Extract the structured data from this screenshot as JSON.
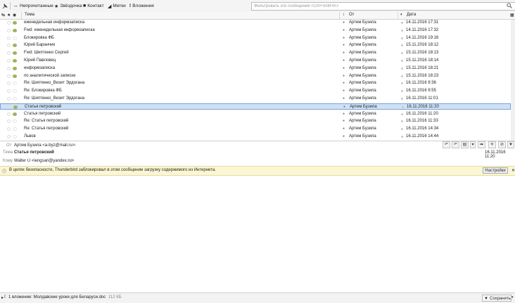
{
  "filterbar": {
    "unread": "Непрочитанные",
    "starred": "Звёздочка",
    "contact": "Контакт",
    "tags": "Метки",
    "attachments": "Вложения",
    "placeholder": "Фильтровать эти сообщения <Ctrl+Shift+K>"
  },
  "columns": {
    "subject": "Тема",
    "from": "От",
    "date": "Дата"
  },
  "messages": [
    {
      "subject": "еженедельная информзаписка",
      "from": "Артем Бузила",
      "date": "14.11.2016 17:31",
      "tagged": true
    },
    {
      "subject": "Fwd: еженедельная информзаписка",
      "from": "Артем Бузила",
      "date": "14.11.2016 17:32",
      "tagged": true
    },
    {
      "subject": "Блокировка ФБ",
      "from": "Артем Бузила",
      "date": "14.11.2016 19:16",
      "tagged": false
    },
    {
      "subject": "Юрий Баранчик",
      "from": "Артем Бузила",
      "date": "15.11.2016 18:12",
      "tagged": true
    },
    {
      "subject": "Fwd: Шиптенко Сергей",
      "from": "Артем Бузила",
      "date": "15.11.2016 18:13",
      "tagged": true
    },
    {
      "subject": "Юрий Павловец",
      "from": "Артем Бузила",
      "date": "15.11.2016 18:14",
      "tagged": true
    },
    {
      "subject": "информзаписка",
      "from": "Артем Бузила",
      "date": "15.11.2016 18:21",
      "tagged": true
    },
    {
      "subject": "по аналитической записке",
      "from": "Артем Бузила",
      "date": "15.11.2016 18:23",
      "tagged": true
    },
    {
      "subject": "Re: Шиптенко_Визит Эрдогана",
      "from": "Артем Бузила",
      "date": "16.11.2016 9:36",
      "tagged": false
    },
    {
      "subject": "Re: Блокировка ФБ",
      "from": "Артем Бузила",
      "date": "16.11.2016 9:55",
      "tagged": false
    },
    {
      "subject": "Re: Шиптенко_Визит Эрдогана",
      "from": "Артем Бузила",
      "date": "16.11.2016 11:01",
      "tagged": false
    },
    {
      "subject": "Статья петровский",
      "from": "Артем Бузила",
      "date": "16.11.2016 11:20",
      "tagged": true,
      "selected": true
    },
    {
      "subject": "Статья петровский",
      "from": "Артем Бузила",
      "date": "16.11.2016 11:20",
      "tagged": true
    },
    {
      "subject": "Re: Статья петровский",
      "from": "Артем Бузила",
      "date": "16.11.2016 11:33",
      "tagged": false
    },
    {
      "subject": "Re: Статья петровский",
      "from": "Артем Бузила",
      "date": "16.11.2016 14:34",
      "tagged": false
    },
    {
      "subject": "Львов",
      "from": "Артем Бузила",
      "date": "16.11.2016 14:44",
      "tagged": false
    }
  ],
  "header": {
    "from_label": "От",
    "from_value": "Артем Бузила <a-byz@mail.ru>",
    "subject_label": "Тема",
    "subject_value": "Статья петровский",
    "to_label": "Кому",
    "to_value": "Walter U <iengsari@yandex.ru>",
    "date_value": "16.11.2016 11:20"
  },
  "notification": {
    "text": "В целях безопасности, Thunderbird заблокировал в этом сообщении загрузку содержимого из Интернета.",
    "settings": "Настройки"
  },
  "attachment": {
    "text": "1 вложение: Молдавские уроки для Беларуси.doc",
    "size": "112 КБ",
    "save": "Сохранить"
  },
  "colors": {
    "tag": "#9cb35c",
    "selection": "#cde2f7",
    "notify_bg": "#fbf6d4"
  }
}
